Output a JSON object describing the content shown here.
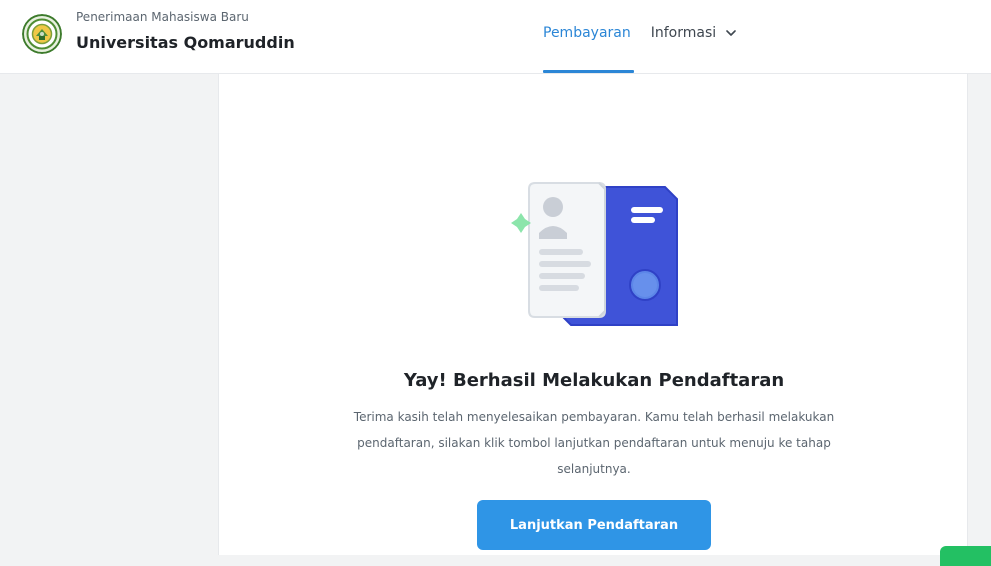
{
  "header": {
    "subtitle": "Penerimaan Mahasiswa Baru",
    "title": "Universitas Qomaruddin",
    "nav": {
      "active": "Pembayaran",
      "dropdown_label": "Informasi"
    }
  },
  "main": {
    "success_title": "Yay! Berhasil Melakukan Pendaftaran",
    "success_desc": "Terima kasih telah menyelesaikan pembayaran. Kamu telah berhasil melakukan pendaftaran, silakan klik tombol lanjutkan pendaftaran untuk menuju ke tahap selanjutnya.",
    "cta_label": "Lanjutkan Pendaftaran"
  },
  "icons": {
    "logo": "university-seal-icon",
    "dropdown": "chevron-down-icon",
    "illustration": "registration-card-illustration"
  },
  "colors": {
    "accent": "#2b86d6",
    "button": "#2f95e6",
    "text_primary": "#1f2328",
    "text_secondary": "#5c6670",
    "card_blue": "#3f53d8"
  }
}
